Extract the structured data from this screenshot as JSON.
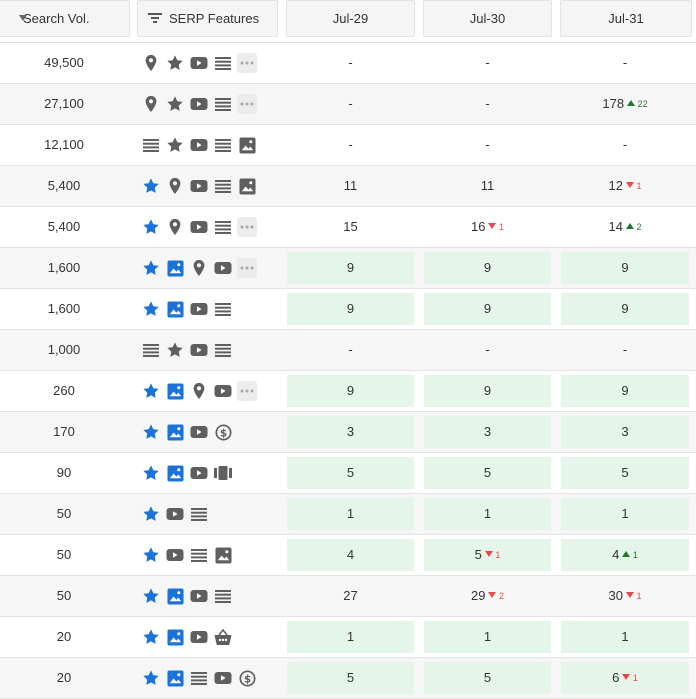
{
  "header": {
    "search_vol_label": "Search Vol.",
    "serp_features_label": "SERP Features",
    "dates": [
      "Jul-29",
      "Jul-30",
      "Jul-31"
    ]
  },
  "colors": {
    "star": "#1a73d9",
    "image_blue": "#1a73d9",
    "grey_icon": "#5f5f5f",
    "top_bg": "#e6f5e9",
    "up": "#1d7a28",
    "down": "#e84a4a"
  },
  "rows": [
    {
      "vol": "49,500",
      "features": [
        "pin-icon",
        "star-icon",
        "video-icon",
        "list-icon",
        "more-icon"
      ],
      "pos": [
        {
          "v": "-"
        },
        {
          "v": "-"
        },
        {
          "v": "-"
        }
      ]
    },
    {
      "vol": "27,100",
      "features": [
        "pin-icon",
        "star-icon",
        "video-icon",
        "list-icon",
        "more-icon"
      ],
      "pos": [
        {
          "v": "-"
        },
        {
          "v": "-"
        },
        {
          "v": "178",
          "d": "up",
          "c": "22"
        }
      ]
    },
    {
      "vol": "12,100",
      "features": [
        "list-icon",
        "star-icon",
        "video-icon",
        "list-icon",
        "image-grey-icon"
      ],
      "pos": [
        {
          "v": "-"
        },
        {
          "v": "-"
        },
        {
          "v": "-"
        }
      ]
    },
    {
      "vol": "5,400",
      "features": [
        "star-blue-icon",
        "pin-icon",
        "video-icon",
        "list-icon",
        "image-grey-icon"
      ],
      "pos": [
        {
          "v": "11"
        },
        {
          "v": "11"
        },
        {
          "v": "12",
          "d": "down",
          "c": "1"
        }
      ]
    },
    {
      "vol": "5,400",
      "features": [
        "star-blue-icon",
        "pin-icon",
        "video-icon",
        "list-icon",
        "more-icon"
      ],
      "pos": [
        {
          "v": "15"
        },
        {
          "v": "16",
          "d": "down",
          "c": "1"
        },
        {
          "v": "14",
          "d": "up",
          "c": "2"
        }
      ]
    },
    {
      "vol": "1,600",
      "features": [
        "star-blue-icon",
        "image-blue-icon",
        "pin-icon",
        "video-icon",
        "more-icon"
      ],
      "pos": [
        {
          "v": "9",
          "top": true
        },
        {
          "v": "9",
          "top": true
        },
        {
          "v": "9",
          "top": true
        }
      ]
    },
    {
      "vol": "1,600",
      "features": [
        "star-blue-icon",
        "image-blue-icon",
        "video-icon",
        "list-icon"
      ],
      "pos": [
        {
          "v": "9",
          "top": true
        },
        {
          "v": "9",
          "top": true
        },
        {
          "v": "9",
          "top": true
        }
      ]
    },
    {
      "vol": "1,000",
      "features": [
        "list-icon",
        "star-icon",
        "video-icon",
        "list-icon"
      ],
      "pos": [
        {
          "v": "-"
        },
        {
          "v": "-"
        },
        {
          "v": "-"
        }
      ]
    },
    {
      "vol": "260",
      "features": [
        "star-blue-icon",
        "image-blue-icon",
        "pin-icon",
        "video-icon",
        "more-icon"
      ],
      "pos": [
        {
          "v": "9",
          "top": true
        },
        {
          "v": "9",
          "top": true
        },
        {
          "v": "9",
          "top": true
        }
      ]
    },
    {
      "vol": "170",
      "features": [
        "star-blue-icon",
        "image-blue-icon",
        "video-icon",
        "dollar-icon"
      ],
      "pos": [
        {
          "v": "3",
          "top": true
        },
        {
          "v": "3",
          "top": true
        },
        {
          "v": "3",
          "top": true
        }
      ]
    },
    {
      "vol": "90",
      "features": [
        "star-blue-icon",
        "image-blue-icon",
        "video-icon",
        "carousel-icon"
      ],
      "pos": [
        {
          "v": "5",
          "top": true
        },
        {
          "v": "5",
          "top": true
        },
        {
          "v": "5",
          "top": true
        }
      ]
    },
    {
      "vol": "50",
      "features": [
        "star-blue-icon",
        "video-icon",
        "list-icon"
      ],
      "pos": [
        {
          "v": "1",
          "top": true
        },
        {
          "v": "1",
          "top": true
        },
        {
          "v": "1",
          "top": true
        }
      ]
    },
    {
      "vol": "50",
      "features": [
        "star-blue-icon",
        "video-icon",
        "list-icon",
        "image-grey-icon"
      ],
      "pos": [
        {
          "v": "4",
          "top": true
        },
        {
          "v": "5",
          "top": true,
          "d": "down",
          "c": "1"
        },
        {
          "v": "4",
          "top": true,
          "d": "up",
          "c": "1"
        }
      ]
    },
    {
      "vol": "50",
      "features": [
        "star-blue-icon",
        "image-blue-icon",
        "video-icon",
        "list-icon"
      ],
      "pos": [
        {
          "v": "27"
        },
        {
          "v": "29",
          "d": "down",
          "c": "2"
        },
        {
          "v": "30",
          "d": "down",
          "c": "1"
        }
      ]
    },
    {
      "vol": "20",
      "features": [
        "star-blue-icon",
        "image-blue-icon",
        "video-icon",
        "basket-icon"
      ],
      "pos": [
        {
          "v": "1",
          "top": true
        },
        {
          "v": "1",
          "top": true
        },
        {
          "v": "1",
          "top": true
        }
      ]
    },
    {
      "vol": "20",
      "features": [
        "star-blue-icon",
        "image-blue-icon",
        "list-icon",
        "video-icon",
        "dollar-icon"
      ],
      "pos": [
        {
          "v": "5",
          "top": true
        },
        {
          "v": "5",
          "top": true
        },
        {
          "v": "6",
          "top": true,
          "d": "down",
          "c": "1"
        }
      ]
    }
  ]
}
